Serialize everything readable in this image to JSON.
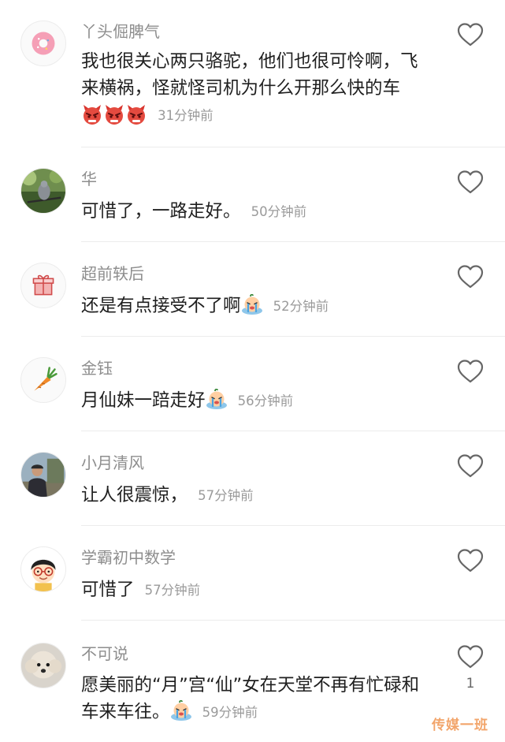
{
  "comments": [
    {
      "user": "丫头倔脾气",
      "text": "我也很关心两只骆驼，他们也很可怜啊，飞来横祸，怪就怪司机为什么开那么快的车",
      "time": "31分钟前",
      "avatar": "donut-avatar",
      "emoji": "angry-devil-emoji"
    },
    {
      "user": "华",
      "text": "可惜了，一路走好。",
      "time": "50分钟前",
      "avatar": "bird-photo-avatar"
    },
    {
      "user": "超前轶后",
      "text": "还是有点接受不了啊",
      "time": "52分钟前",
      "avatar": "gift-box-avatar",
      "emoji": "crying-face-emoji"
    },
    {
      "user": "金钰",
      "text": "月仙妹一踣走好",
      "time": "56分钟前",
      "avatar": "carrot-avatar",
      "emoji": "crying-face-emoji"
    },
    {
      "user": "小月清风",
      "text": "让人很震惊，",
      "time": "57分钟前",
      "avatar": "man-photo-avatar"
    },
    {
      "user": "学霸初中数学",
      "text": "可惜了",
      "time": "57分钟前",
      "avatar": "cartoon-boy-avatar"
    },
    {
      "user": "不可说",
      "text": "愿美丽的“月”宫“仙”女在天堂不再有忙碌和车来车往。",
      "time": "59分钟前",
      "avatar": "poodle-dog-avatar",
      "emoji": "crying-face-emoji",
      "likes": "1"
    }
  ],
  "watermark": "传媒一班",
  "colors": {
    "username": "#8e8e8e",
    "text": "#1f1f1f",
    "time": "#9a9a9a",
    "divider": "#ececec",
    "watermark": "#f2a56b"
  }
}
